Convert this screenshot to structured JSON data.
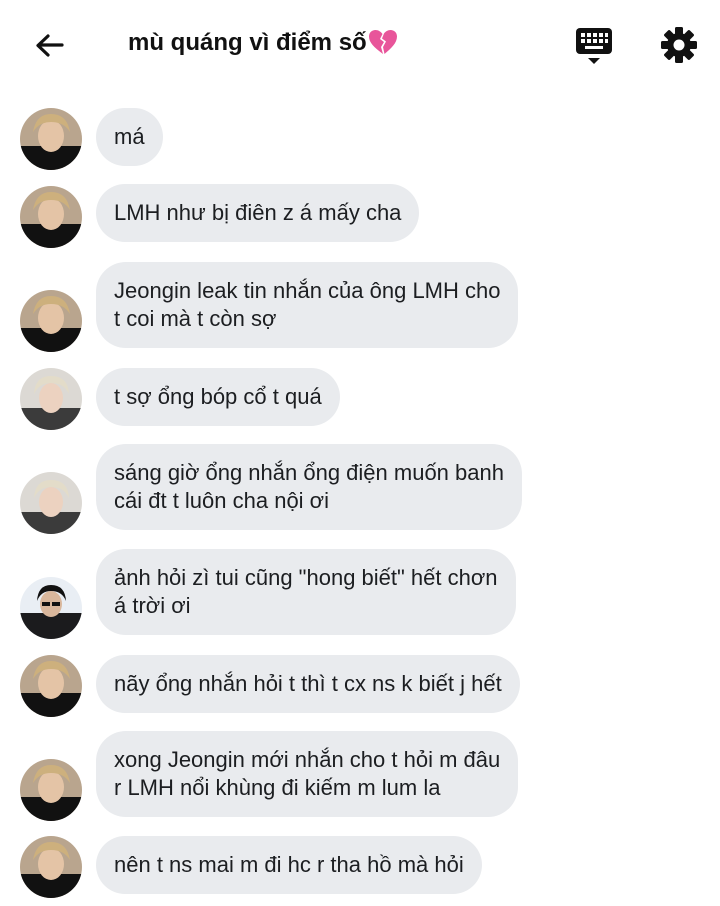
{
  "header": {
    "title": "mù quáng vì điểm số",
    "title_emoji": "broken-heart-icon"
  },
  "colors": {
    "bubble_bg": "#e9ebee",
    "text": "#1c1e21",
    "heart": "#e8559a"
  },
  "messages": [
    {
      "avatar": "avatar-a",
      "lines": [
        "má"
      ]
    },
    {
      "avatar": "avatar-a",
      "lines": [
        "LMH như bị điên z á mấy cha"
      ]
    },
    {
      "avatar": "avatar-a",
      "lines": [
        "Jeongin leak tin nhắn của ông LMH cho",
        "t coi mà t còn sợ"
      ]
    },
    {
      "avatar": "avatar-b",
      "lines": [
        "t sợ ổng bóp cổ t quá"
      ]
    },
    {
      "avatar": "avatar-b",
      "lines": [
        "sáng giờ ổng nhắn ổng điện muốn banh",
        "cái đt t luôn cha nội ơi"
      ]
    },
    {
      "avatar": "avatar-c",
      "lines": [
        "ảnh hỏi zì tui cũng \"hong biết\" hết chơn",
        "á trời ơi"
      ]
    },
    {
      "avatar": "avatar-a",
      "lines": [
        "nãy ổng nhắn hỏi t thì t cx ns k biết j hết"
      ]
    },
    {
      "avatar": "avatar-a",
      "lines": [
        "xong Jeongin mới nhắn cho t hỏi m đâu",
        "r LMH nổi khùng đi kiếm m lum la"
      ]
    },
    {
      "avatar": "avatar-a",
      "lines": [
        "nên t ns mai m đi hc r tha hồ mà hỏi"
      ]
    }
  ]
}
